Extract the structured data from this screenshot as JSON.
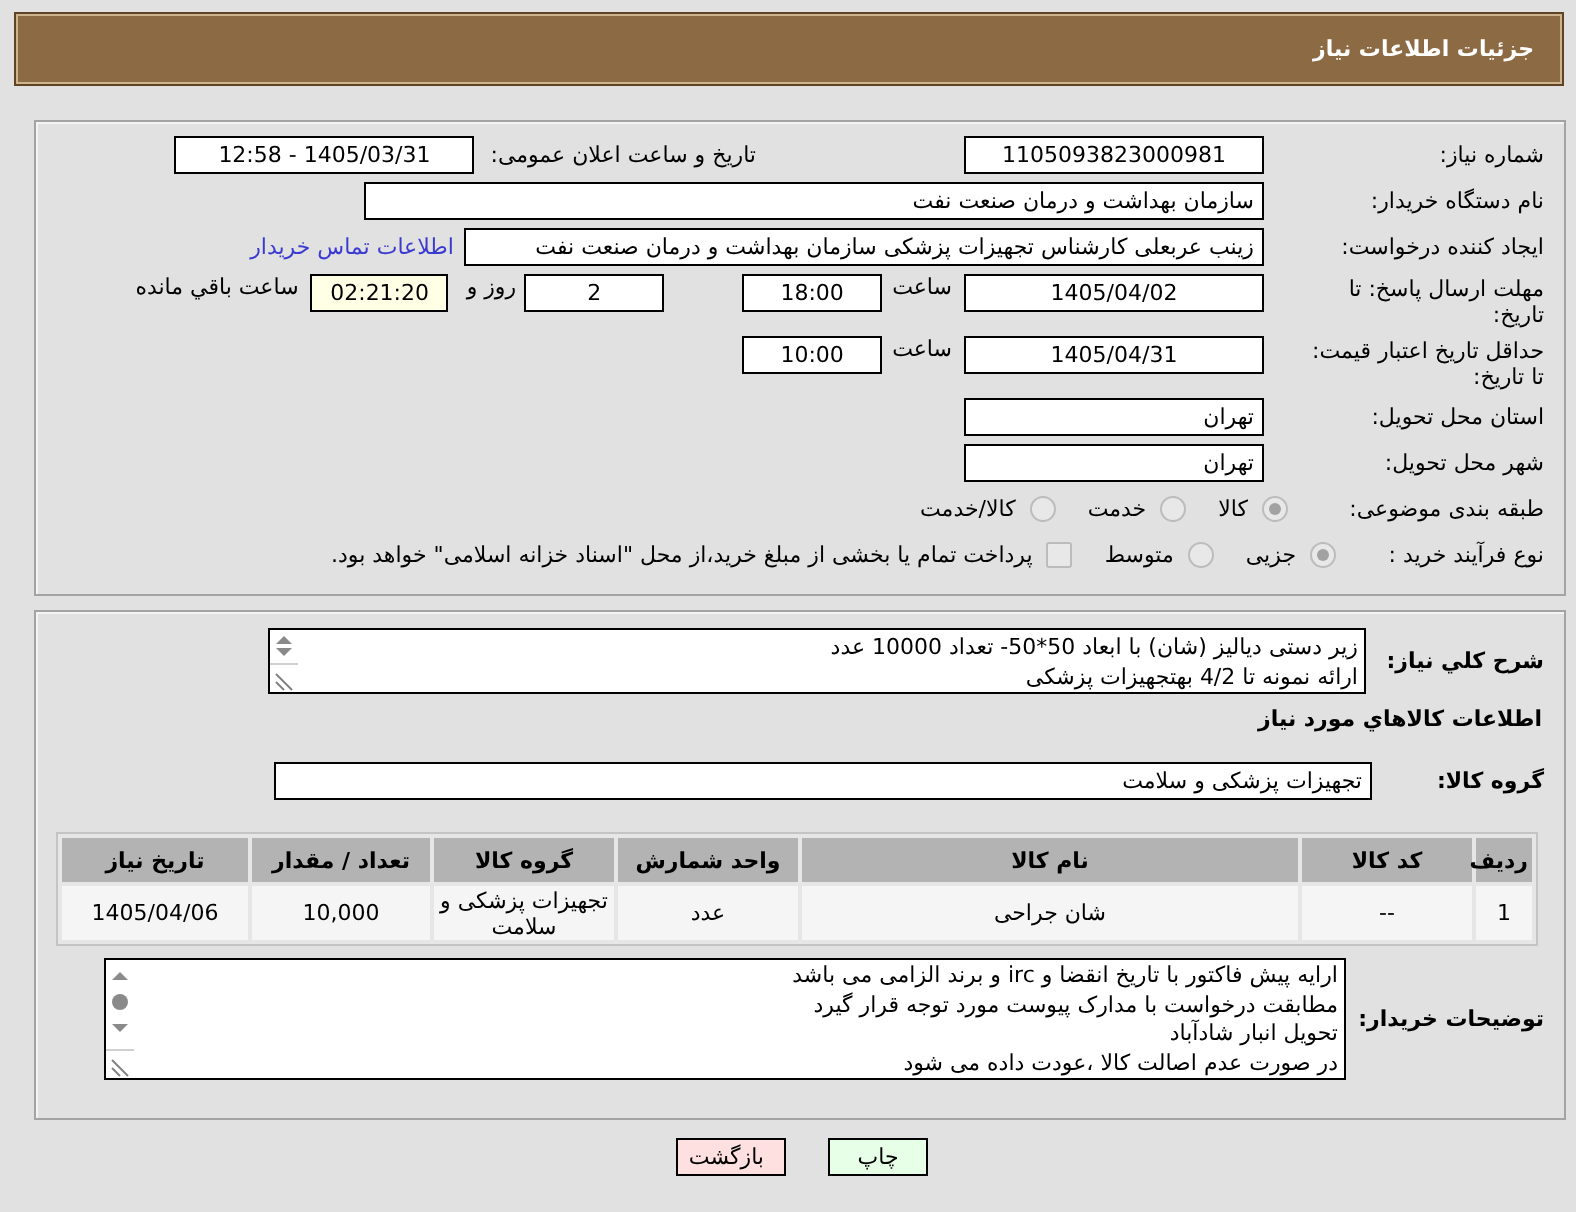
{
  "header": {
    "title": "جزئیات اطلاعات نیاز"
  },
  "details": {
    "need_number": {
      "label": "شماره نیاز:",
      "value": "1105093823000981"
    },
    "announcement": {
      "label": "تاریخ و ساعت اعلان عمومی:",
      "value": "1405/03/31 - 12:58"
    },
    "buyer_org": {
      "label": "نام دستگاه خریدار:",
      "value": "سازمان بهداشت و درمان صنعت نفت"
    },
    "requester": {
      "label": "ایجاد کننده درخواست:",
      "value": "زینب عربعلی کارشناس تجهیزات پزشکی سازمان بهداشت و درمان صنعت نفت",
      "contact_link": "اطلاعات تماس خریدار"
    },
    "response_deadline": {
      "label": "مهلت ارسال پاسخ: تا تاریخ:",
      "date": "1405/04/02",
      "time_label": "ساعت",
      "time": "18:00",
      "days": "2",
      "days_label": "روز و",
      "remaining": "02:21:20",
      "remaining_label": "ساعت باقي مانده"
    },
    "price_validity": {
      "label": "حداقل تاریخ اعتبار قیمت: تا تاریخ:",
      "date": "1405/04/31",
      "time_label": "ساعت",
      "time": "10:00"
    },
    "delivery_province": {
      "label": "استان محل تحویل:",
      "value": "تهران"
    },
    "delivery_city": {
      "label": "شهر محل تحویل:",
      "value": "تهران"
    },
    "subject_category": {
      "label": "طبقه بندی موضوعی:",
      "options": [
        {
          "label": "کالا",
          "selected": true,
          "disabled": true
        },
        {
          "label": "خدمت",
          "selected": false,
          "disabled": true
        },
        {
          "label": "کالا/خدمت",
          "selected": false,
          "disabled": true
        }
      ]
    },
    "purchase_process": {
      "label": "نوع فرآیند خرید :",
      "options": [
        {
          "label": "جزیی",
          "selected": true,
          "disabled": true
        },
        {
          "label": "متوسط",
          "selected": false,
          "disabled": true
        }
      ],
      "treasury_option": {
        "label": "پرداخت تمام یا بخشی از مبلغ خرید،از محل \"اسناد خزانه اسلامی\" خواهد بود.",
        "checked": false,
        "disabled": true
      }
    }
  },
  "need": {
    "description_label": "شرح کلي نياز:",
    "description_lines": [
      "زیر دستی دیالیز (شان) با ابعاد 50*50- تعداد 10000 عدد",
      "ارائه نمونه تا 4/2 بهتجهیزات پزشکی"
    ],
    "goods_title": "اطلاعات کالاهاي مورد نياز",
    "goods_group_label": "گروه کالا:",
    "goods_group": "تجهیزات پزشکی و سلامت",
    "table": {
      "columns": [
        "ردیف",
        "کد کالا",
        "نام کالا",
        "واحد شمارش",
        "گروه کالا",
        "تعداد / مقدار",
        "تاریخ نیاز"
      ],
      "rows": [
        [
          "1",
          "--",
          "شان جراحی",
          "عدد",
          "تجهیزات پزشکی و سلامت",
          "10,000",
          "1405/04/06"
        ]
      ]
    },
    "buyer_notes_label": "توضیحات خریدار:",
    "buyer_notes_lines": [
      "ارایه  پیش فاکتور با تاریخ انقضا و irc  و برند الزامی می باشد",
      "مطابقت درخواست با مدارک پیوست مورد توجه قرار گیرد",
      "تحویل انبار شادآباد",
      "در صورت عدم اصالت کالا ،عودت داده می شود"
    ]
  },
  "buttons": [
    {
      "label": "چاپ",
      "kind": "print"
    },
    {
      "label": "بازگشت",
      "kind": "back"
    }
  ]
}
